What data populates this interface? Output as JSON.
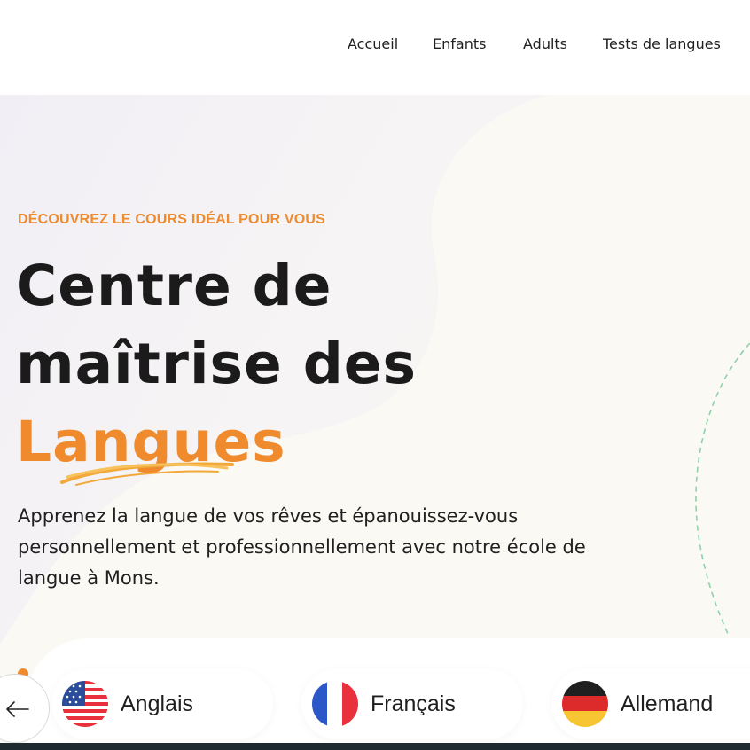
{
  "nav": {
    "items": [
      {
        "label": "Accueil"
      },
      {
        "label": "Enfants"
      },
      {
        "label": "Adults"
      },
      {
        "label": "Tests de langues"
      }
    ]
  },
  "hero": {
    "eyebrow": "DÉCOUVREZ LE COURS IDÉAL POUR VOUS",
    "title_line1": "Centre de",
    "title_line2": "maîtrise des",
    "title_accent": "Langues",
    "subtitle": "Apprenez la langue de vos rêves et épanouissez-vous personnellement et professionnellement avec notre école de langue à Mons."
  },
  "languages": [
    {
      "label": "Anglais",
      "icon": "us-flag-icon"
    },
    {
      "label": "Français",
      "icon": "france-flag-icon"
    },
    {
      "label": "Allemand",
      "icon": "germany-flag-icon"
    }
  ],
  "colors": {
    "accent": "#ef8a2d",
    "text": "#1b1b1b",
    "decor_dashed": "#8fd1a8"
  }
}
